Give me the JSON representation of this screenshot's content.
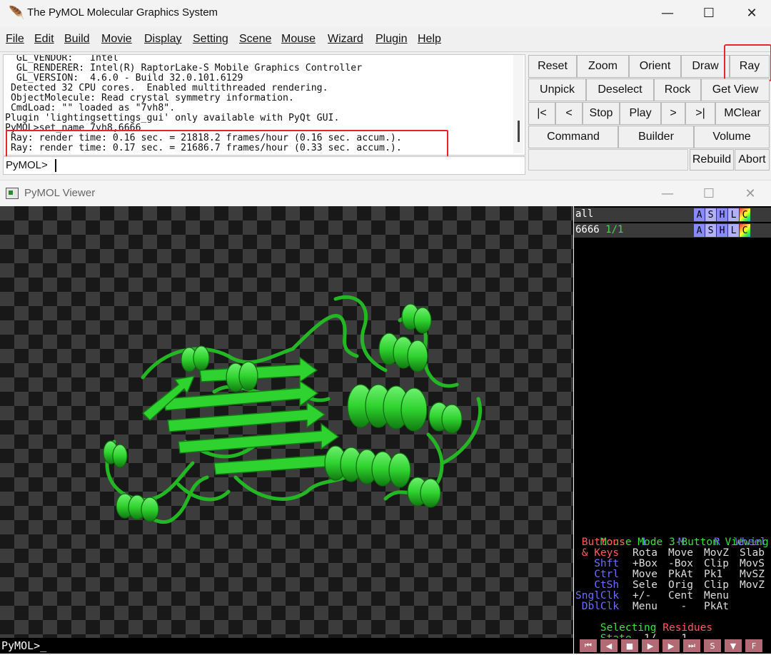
{
  "window": {
    "title": "The PyMOL Molecular Graphics System",
    "minimize": "—",
    "maximize": "☐",
    "close": "✕"
  },
  "menu": [
    "File",
    "Edit",
    "Build",
    "Movie",
    "Display",
    "Setting",
    "Scene",
    "Mouse",
    "Wizard",
    "Plugin",
    "Help"
  ],
  "console": {
    "lines": [
      "  GL_VENDOR:   Intel",
      "  GL_RENDERER: Intel(R) RaptorLake-S Mobile Graphics Controller",
      "  GL_VERSION:  4.6.0 - Build 32.0.101.6129",
      " Detected 32 CPU cores.  Enabled multithreaded rendering.",
      " ObjectMolecule: Read crystal symmetry information.",
      " CmdLoad: \"\" loaded as \"7vh8\".",
      "Plugin 'lightingsettings_gui' only available with PyQt GUI.",
      "PyMOL>set_name 7vh8,6666",
      " Ray: render time: 0.16 sec. = 21818.2 frames/hour (0.16 sec. accum.).",
      " Ray: render time: 0.17 sec. = 21686.7 frames/hour (0.33 sec. accum.)."
    ],
    "prompt": "PyMOL>"
  },
  "buttons": {
    "row1": [
      "Reset",
      "Zoom",
      "Orient",
      "Draw",
      "Ray"
    ],
    "row2": [
      "Unpick",
      "Deselect",
      "Rock",
      "Get View"
    ],
    "row3": [
      "|<",
      "<",
      "Stop",
      "Play",
      ">",
      ">|",
      "MClear"
    ],
    "row4": [
      "Command",
      "Builder",
      "Volume"
    ],
    "row5": [
      "Rebuild",
      "Abort"
    ]
  },
  "viewer": {
    "title": "PyMOL Viewer",
    "objects": [
      {
        "name": "all",
        "state": ""
      },
      {
        "name": "6666",
        "state": "1/1"
      }
    ],
    "flags": [
      "A",
      "S",
      "H",
      "L",
      "C"
    ],
    "cmd_prompt": "PyMOL>_"
  },
  "mouse_grid": {
    "title_a": "Mouse Mode ",
    "title_b": "3-Button Viewing",
    "buttons_row": [
      " Buttons",
      "L",
      "M",
      "R",
      "Wheel"
    ],
    "rows": [
      {
        "mod": " & Keys",
        "l": "Rota",
        "m": "Move",
        "r": "MovZ",
        "w": "Slab"
      },
      {
        "mod": "   Shft",
        "l": "+Box",
        "m": "-Box",
        "r": "Clip",
        "w": "MovS"
      },
      {
        "mod": "   Ctrl",
        "l": "Move",
        "m": "PkAt",
        "r": "Pk1",
        "w": "MvSZ"
      },
      {
        "mod": "   CtSh",
        "l": "Sele",
        "m": "Orig",
        "r": "Clip",
        "w": "MovZ"
      },
      {
        "mod": "SnglClk",
        "l": "+/-",
        "m": "Cent",
        "r": "Menu",
        "w": ""
      },
      {
        "mod": " DblClk",
        "l": "Menu",
        "m": "  -",
        "r": "PkAt",
        "w": ""
      }
    ],
    "selecting_a": "Selecting ",
    "selecting_b": "Residues",
    "state_label": "State",
    "state_value": "  1/    1"
  },
  "colors": {
    "highlight": "#e8262a",
    "protein": "#2fd32f",
    "panel_bg": "#000000"
  }
}
